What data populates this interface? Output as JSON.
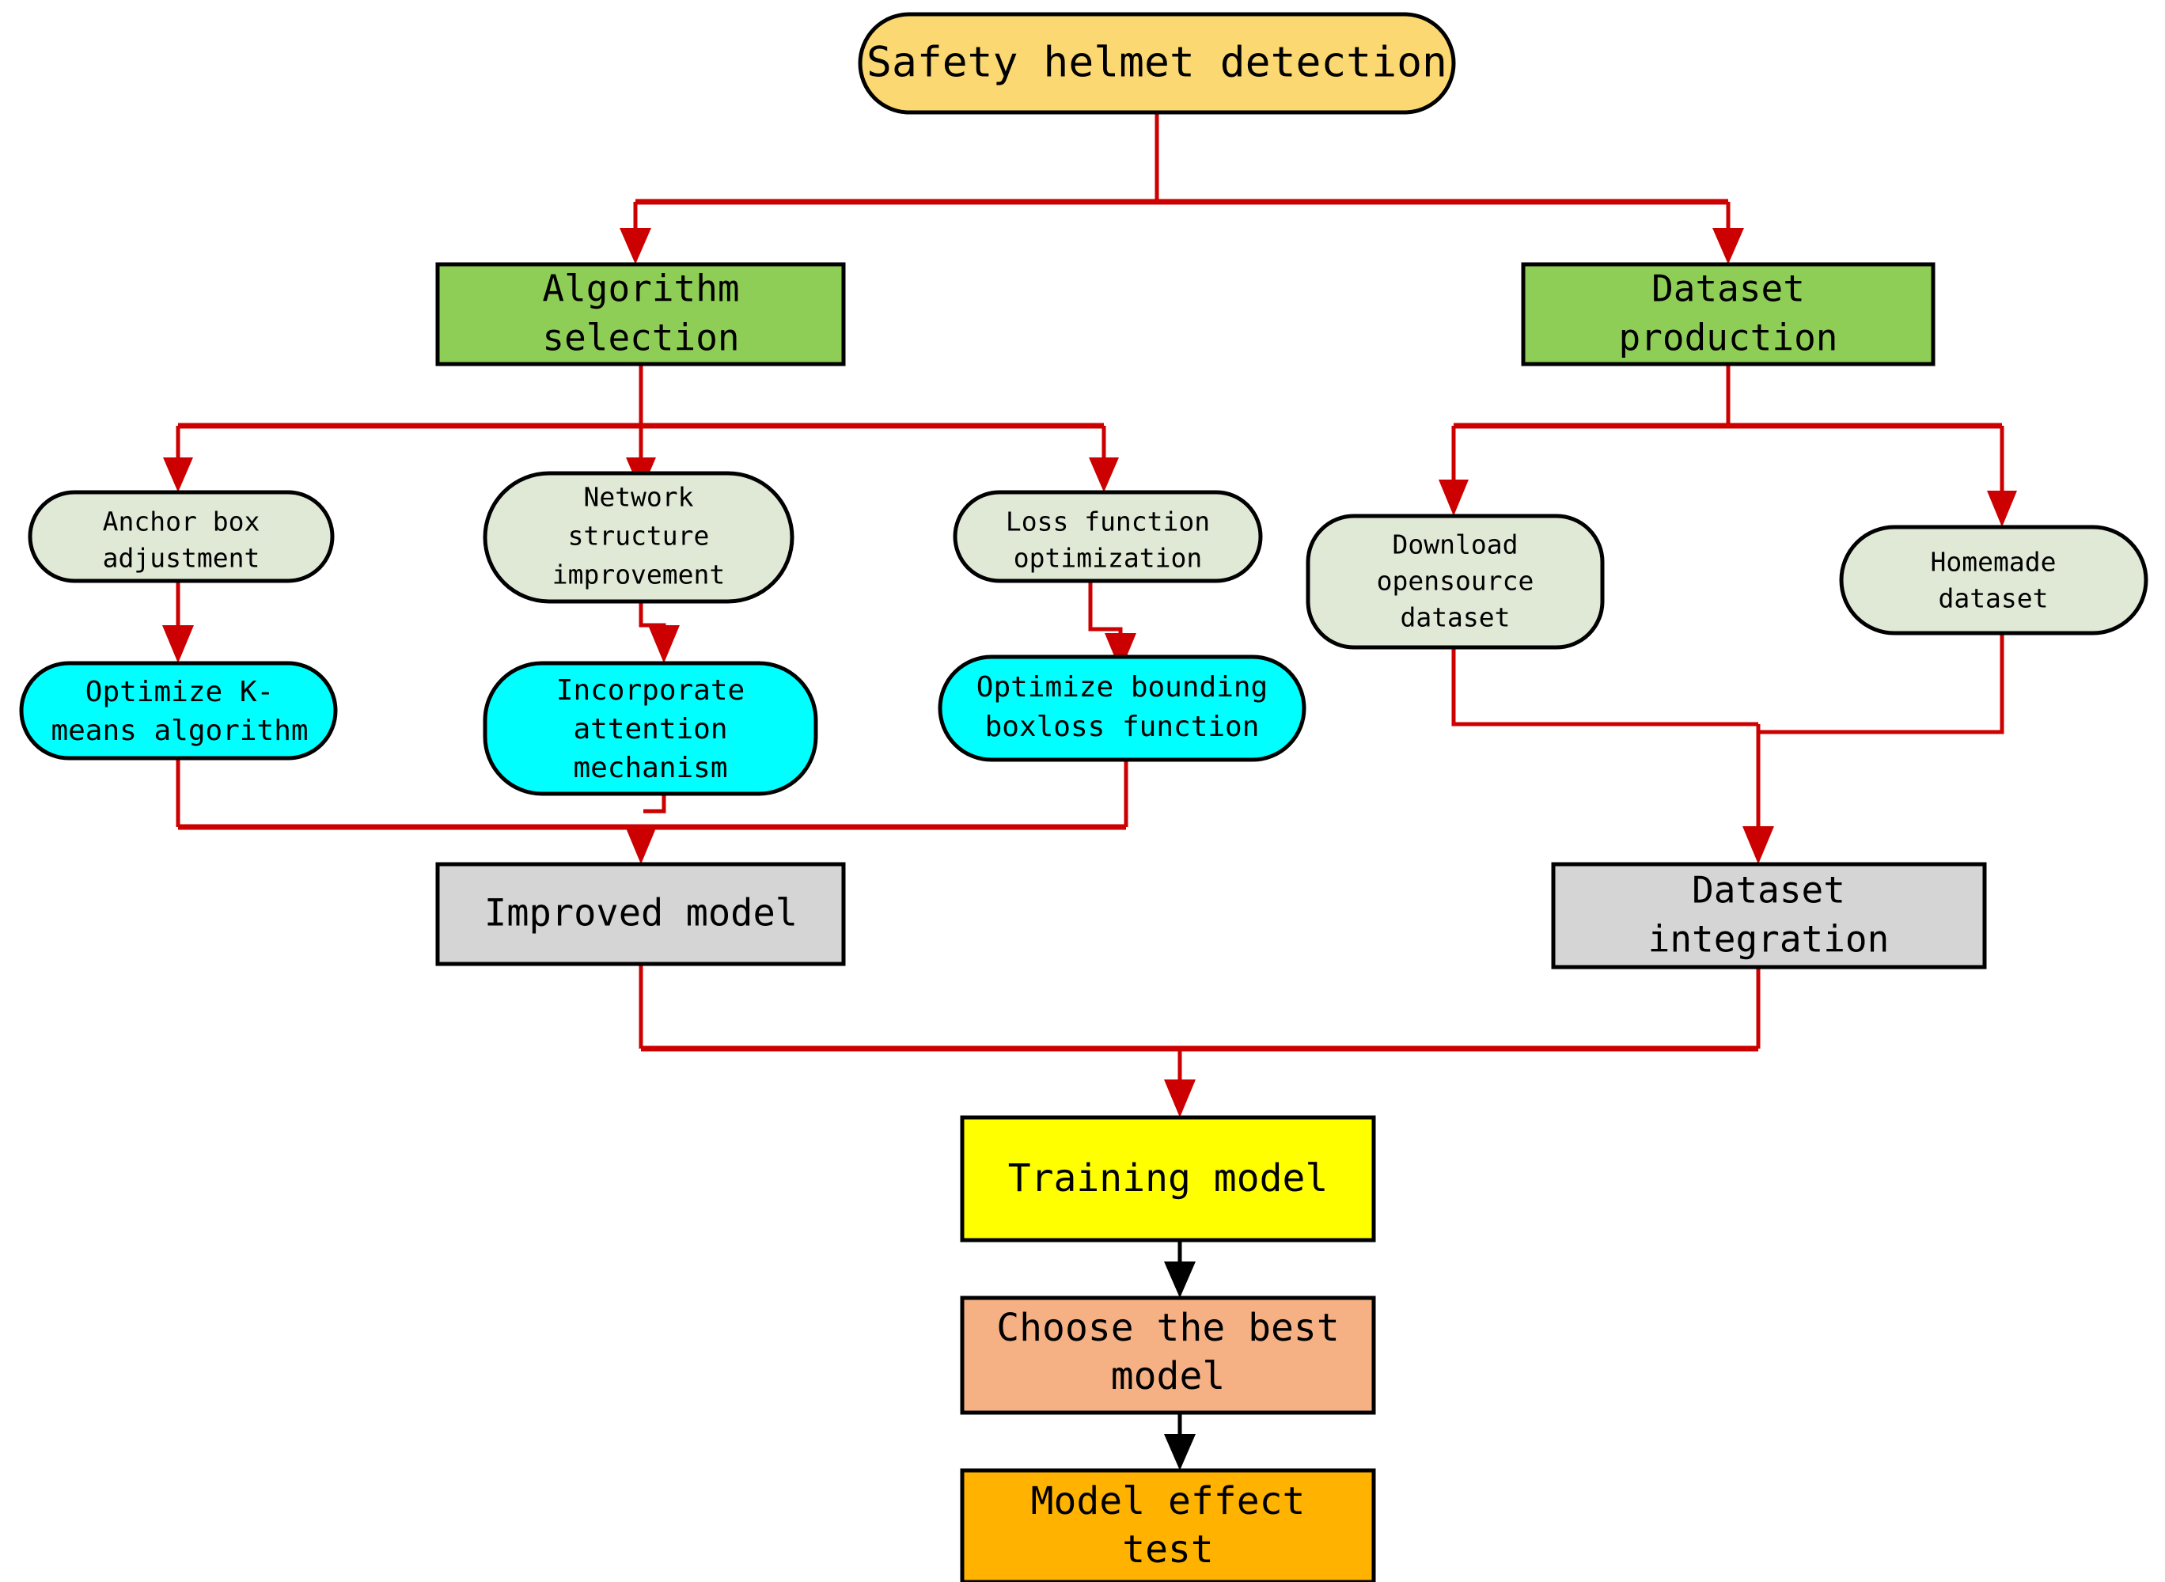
{
  "diagram": {
    "title": "Safety helmet detection flowchart",
    "type": "flowchart",
    "colors": {
      "root_fill": "#FBD871",
      "stage_fill": "#8FCE56",
      "pale_green_fill": "#E0E9D6",
      "cyan_fill": "#00FFFF",
      "gray_fill": "#D5D5D5",
      "yellow_fill": "#FFFF00",
      "salmon_fill": "#F5B183",
      "orange_fill": "#FFB300",
      "edge_red": "#CC0000",
      "edge_black": "#000000",
      "border": "#000000"
    },
    "nodes": {
      "root": "Safety helmet detection",
      "algorithm_selection_line1": "Algorithm",
      "algorithm_selection_line2": "selection",
      "dataset_production_line1": "Dataset",
      "dataset_production_line2": "production",
      "anchor_box_line1": "Anchor box",
      "anchor_box_line2": "adjustment",
      "network_structure_line1": "Network",
      "network_structure_line2": "structure",
      "network_structure_line3": "improvement",
      "loss_function_line1": "Loss function",
      "loss_function_line2": "optimization",
      "download_line1": "Download",
      "download_line2": "opensource",
      "download_line3": "dataset",
      "homemade_line1": "Homemade",
      "homemade_line2": "dataset",
      "optimize_kmeans_line1": "Optimize K-",
      "optimize_kmeans_line2": "means algorithm",
      "incorporate_attention_line1": "Incorporate",
      "incorporate_attention_line2": "attention",
      "incorporate_attention_line3": "mechanism",
      "optimize_bbox_line1": "Optimize bounding",
      "optimize_bbox_line2": "boxloss function",
      "improved_model": "Improved model",
      "dataset_integration_line1": "Dataset",
      "dataset_integration_line2": "integration",
      "training_model": "Training model",
      "choose_best_line1": "Choose the best",
      "choose_best_line2": "model",
      "model_effect_line1": "Model effect",
      "model_effect_line2": "test"
    },
    "edges": [
      "Safety helmet detection → Algorithm selection",
      "Safety helmet detection → Dataset production",
      "Algorithm selection → Anchor box adjustment",
      "Algorithm selection → Network structure improvement",
      "Algorithm selection → Loss function optimization",
      "Anchor box adjustment → Optimize K-means algorithm",
      "Network structure improvement → Incorporate attention mechanism",
      "Loss function optimization → Optimize bounding boxloss function",
      "Optimize K-means algorithm → Improved model",
      "Incorporate attention mechanism → Improved model",
      "Optimize bounding boxloss function → Improved model",
      "Dataset production → Download opensource dataset",
      "Dataset production → Homemade dataset",
      "Download opensource dataset → Dataset integration",
      "Homemade dataset → Dataset integration",
      "Improved model → Training model",
      "Dataset integration → Training model",
      "Training model → Choose the best model",
      "Choose the best model → Model effect test"
    ]
  }
}
